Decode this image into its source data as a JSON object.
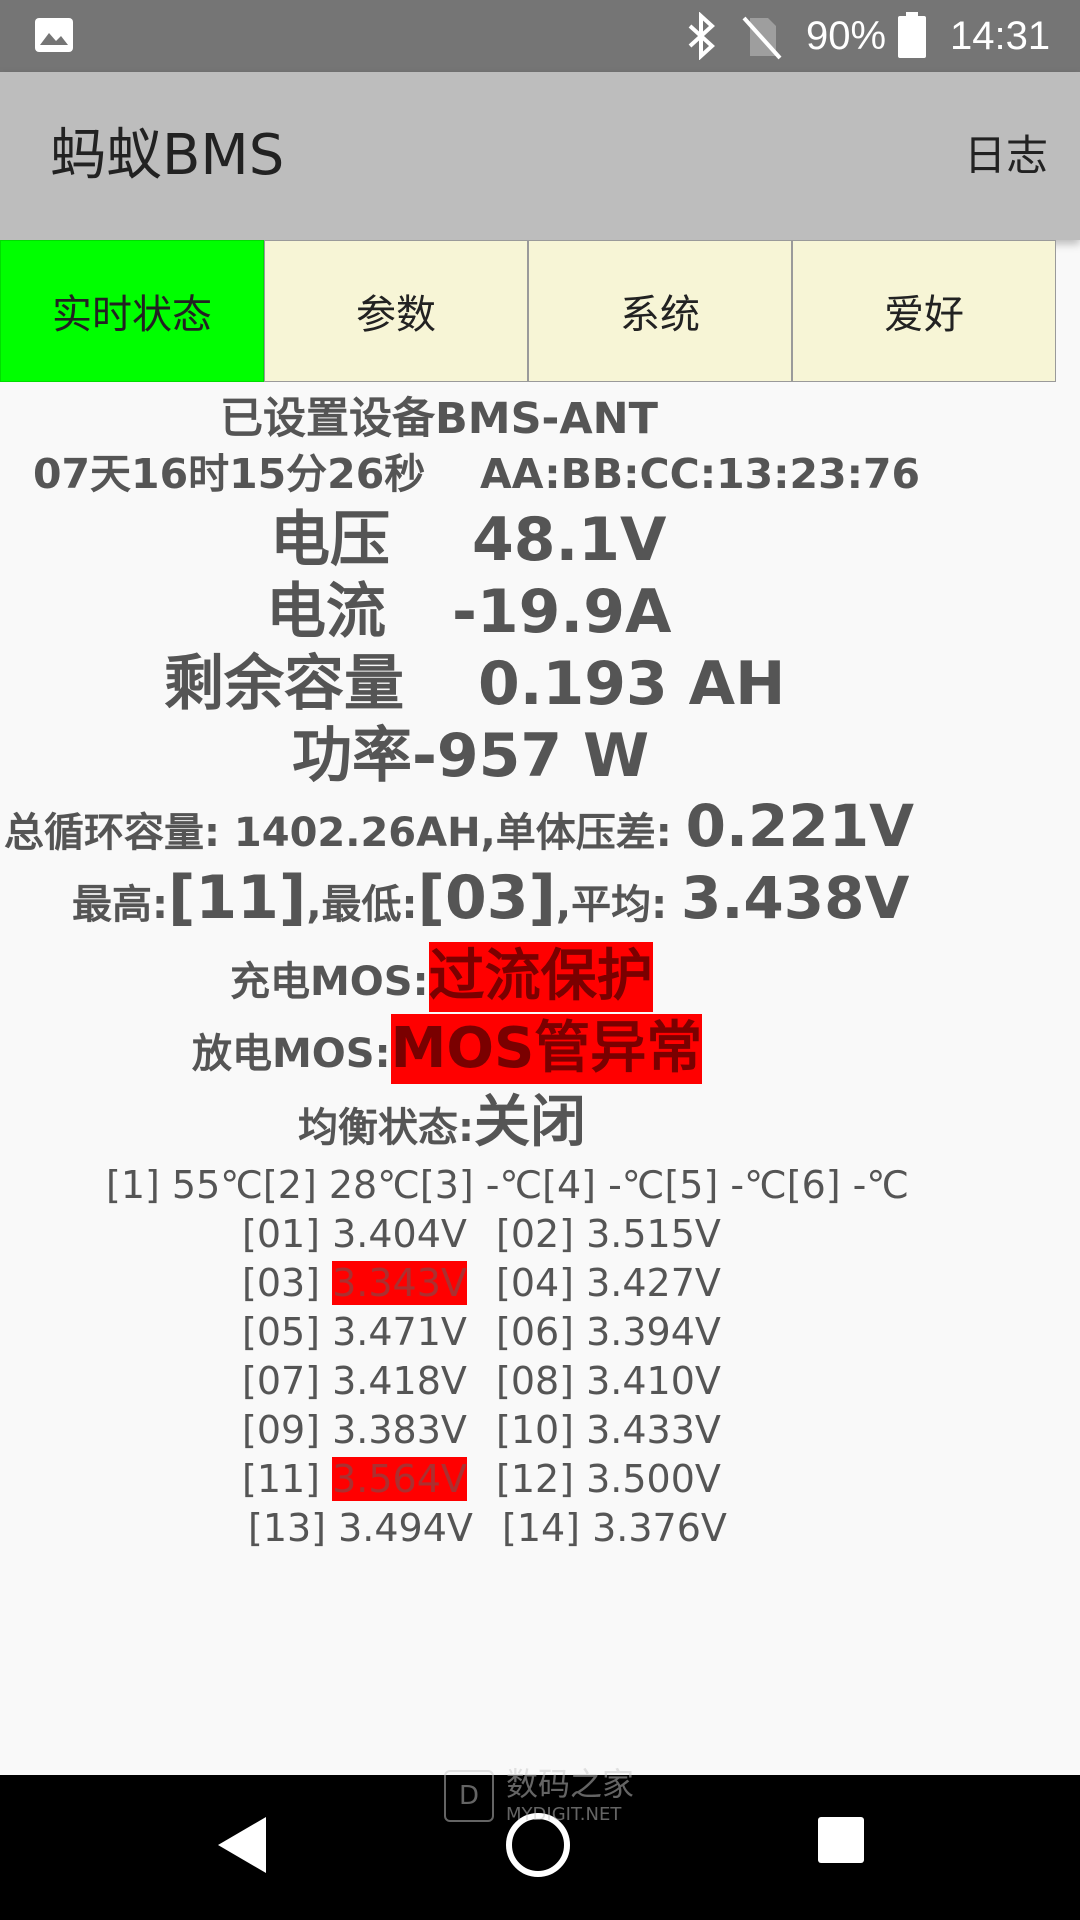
{
  "status_bar": {
    "battery": "90%",
    "time": "14:31"
  },
  "app_bar": {
    "title": "蚂蚁BMS",
    "log": "日志"
  },
  "tabs": [
    {
      "label": "实时状态",
      "active": true
    },
    {
      "label": "参数",
      "active": false
    },
    {
      "label": "系统",
      "active": false
    },
    {
      "label": "爱好",
      "active": false
    }
  ],
  "status": {
    "device": "已设置设备BMS-ANT",
    "uptime": "07天16时15分26秒",
    "mac": "AA:BB:CC:13:23:76",
    "voltage_label": "电压",
    "voltage_value": "48.1V",
    "current_label": "电流",
    "current_value": "-19.9A",
    "capacity_label": "剩余容量",
    "capacity_value": "0.193 AH",
    "power": "功率-957 W",
    "cycle_prefix": "总循环容量: 1402.26AH,单体压差: ",
    "cycle_diff": "0.221V",
    "max_label": "最高:",
    "max_value": "[11]",
    "min_label": ",最低:",
    "min_value": "[03]",
    "avg_label": ",平均: ",
    "avg_value": "3.438V",
    "charge_mos_label": "充电MOS:",
    "charge_mos_value": "过流保护",
    "discharge_mos_label": "放电MOS:",
    "discharge_mos_value": "MOS管异常",
    "balance_label": "均衡状态:",
    "balance_value": "关闭",
    "temps": "[1] 55℃[2] 28℃[3] -℃[4] -℃[5] -℃[6] -℃"
  },
  "cells": [
    {
      "index": "[01]",
      "voltage": "3.404V",
      "highlight": false
    },
    {
      "index": "[02]",
      "voltage": "3.515V",
      "highlight": false
    },
    {
      "index": "[03]",
      "voltage": "3.343V",
      "highlight": true
    },
    {
      "index": "[04]",
      "voltage": "3.427V",
      "highlight": false
    },
    {
      "index": "[05]",
      "voltage": "3.471V",
      "highlight": false
    },
    {
      "index": "[06]",
      "voltage": "3.394V",
      "highlight": false
    },
    {
      "index": "[07]",
      "voltage": "3.418V",
      "highlight": false
    },
    {
      "index": "[08]",
      "voltage": "3.410V",
      "highlight": false
    },
    {
      "index": "[09]",
      "voltage": "3.383V",
      "highlight": false
    },
    {
      "index": "[10]",
      "voltage": "3.433V",
      "highlight": false
    },
    {
      "index": "[11]",
      "voltage": "3.564V",
      "highlight": true
    },
    {
      "index": "[12]",
      "voltage": "3.500V",
      "highlight": false
    },
    {
      "index": "[13]",
      "voltage": "3.494V",
      "highlight": false
    },
    {
      "index": "[14]",
      "voltage": "3.376V",
      "highlight": false
    }
  ],
  "watermark": {
    "text": "数码之家",
    "sub": "MYDIGIT.NET"
  },
  "colors": {
    "active_tab": "#00ff00",
    "alarm": "#ff0000",
    "tab_bg": "#f7f5d6"
  }
}
